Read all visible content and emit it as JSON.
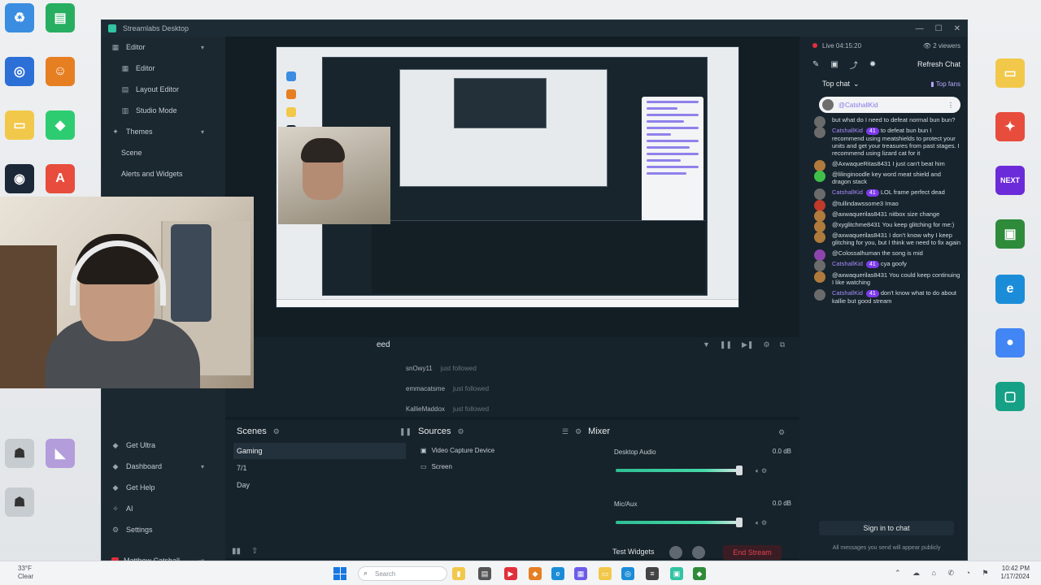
{
  "window": {
    "title": "Streamlabs Desktop"
  },
  "nav": {
    "top_items": [
      {
        "label": "Editor",
        "icon": "editor-icon",
        "expandable": true
      },
      {
        "label": "Editor",
        "icon": "editor-icon",
        "sub": true
      },
      {
        "label": "Layout Editor",
        "icon": "layout-icon",
        "sub": true
      },
      {
        "label": "Studio Mode",
        "icon": "studio-mode-icon",
        "sub": true
      },
      {
        "label": "Themes",
        "icon": "themes-icon",
        "expandable": true
      },
      {
        "label": "Scene",
        "icon": "",
        "sub": true
      },
      {
        "label": "Alerts and Widgets",
        "icon": "",
        "sub": true
      }
    ],
    "bottom_items": [
      {
        "label": "Get Ultra",
        "icon": "ultra-icon"
      },
      {
        "label": "Dashboard",
        "icon": "dashboard-icon",
        "expandable": true
      },
      {
        "label": "Get Help",
        "icon": "help-icon"
      },
      {
        "label": "AI",
        "icon": "ai-icon"
      },
      {
        "label": "Settings",
        "icon": "gear-icon"
      }
    ],
    "user_name": "Matthew Catshall"
  },
  "feed": {
    "title": "Event Feed",
    "title_visible": "eed",
    "rows": [
      {
        "user": "snOwy11",
        "detail": "just followed"
      },
      {
        "user": "emmacatsme",
        "detail": "just followed"
      },
      {
        "user": "KallieMaddox",
        "detail": "just followed"
      }
    ]
  },
  "scenes": {
    "title": "Scenes",
    "items": [
      "Gaming",
      "7/1",
      "Day"
    ],
    "active_index": 0
  },
  "sources": {
    "title": "Sources",
    "items": [
      {
        "label": "Video Capture Device",
        "icon": "camera-icon"
      },
      {
        "label": "Screen",
        "icon": "monitor-icon"
      }
    ]
  },
  "mixer": {
    "title": "Mixer",
    "channels": [
      {
        "name": "Desktop Audio",
        "db": "0.0 dB",
        "level": 0.95
      },
      {
        "name": "Mic/Aux",
        "db": "0.0 dB",
        "level": 0.95
      }
    ]
  },
  "footer": {
    "test_widgets": "Test Widgets",
    "end_stream": "End Stream"
  },
  "chat": {
    "live_label": "Live 04:15:20",
    "viewers": "2 viewers",
    "refresh": "Refresh Chat",
    "top_chat": "Top chat",
    "top_fans": "Top fans",
    "pinned_user": "@CatshallKid",
    "messages": [
      {
        "name": "",
        "text": "but what do I need to defeat normal bun bun?",
        "badge": "",
        "color": "#6b6b6b"
      },
      {
        "name": "CatshallKid",
        "text": "to defeat bun bun I recommend using meatshields to protect your units and get your treasures from past stages. I recommend using lizard cat for it",
        "badge": "41",
        "color": "#6b6b6b"
      },
      {
        "name": "",
        "text": "@AxwaqueRitas8431 I just can't beat him",
        "badge": "",
        "color": "#b07a3c"
      },
      {
        "name": "",
        "text": "@lilinginoodle key word meat shield and dragon stack",
        "badge": "",
        "color": "#3fbf4a"
      },
      {
        "name": "CatshallKid",
        "text": "LOL frame perfect dead",
        "badge": "41",
        "color": "#6b6b6b"
      },
      {
        "name": "",
        "text": "@tullindawssome3 Imao",
        "badge": "",
        "color": "#c0392b"
      },
      {
        "name": "",
        "text": "@axwaquerilas8431 nitbox size change",
        "badge": "",
        "color": "#b07a3c"
      },
      {
        "name": "",
        "text": "@xyglitchme8431 You keep glitching for me:)",
        "badge": "",
        "color": "#b07a3c"
      },
      {
        "name": "",
        "text": "@axwaquerilas8431 I don't know why I keep glitching for you, but I think we need to fix again",
        "badge": "",
        "color": "#b07a3c"
      },
      {
        "name": "",
        "text": "@Colossalhuman the song is mid",
        "badge": "",
        "color": "#8e44ad"
      },
      {
        "name": "CatshallKid",
        "text": "cya goofy",
        "badge": "41",
        "color": "#6b6b6b"
      },
      {
        "name": "",
        "text": "@axwaquerilas8431 You could keep continuing I like watching",
        "badge": "",
        "color": "#b07a3c"
      },
      {
        "name": "CatshallKid",
        "text": "don't know what to do about kallie but good stream",
        "badge": "41",
        "color": "#6b6b6b"
      }
    ],
    "sign_in": "Sign in to chat",
    "note": "All messages you send will appear publicly"
  },
  "desktop_icons": [
    {
      "label": "Recycle Bin",
      "color": "#3a8de0"
    },
    {
      "label": "Ubisoft",
      "color": "#2c6fd6"
    },
    {
      "label": "Folder",
      "color": "#f2c84b"
    },
    {
      "label": "Steam",
      "color": "#1b2838"
    },
    {
      "label": "",
      "color": "#27ae60"
    },
    {
      "label": "",
      "color": "#e67e22"
    },
    {
      "label": "",
      "color": "#2ecc71"
    },
    {
      "label": "",
      "color": "#e74c3c"
    },
    {
      "label": "Folder",
      "color": "#f2c84b"
    },
    {
      "label": "",
      "color": "#e74c3c"
    },
    {
      "label": "NEXT",
      "color": "#6c2bd9"
    },
    {
      "label": "",
      "color": "#2e8b3a"
    },
    {
      "label": "Edge",
      "color": "#1b8dd8"
    },
    {
      "label": "Chrome",
      "color": "#4285f4"
    },
    {
      "label": "",
      "color": "#16a085"
    }
  ],
  "taskbar": {
    "weather_temp": "33°F",
    "weather_desc": "Clear",
    "search_placeholder": "Search",
    "time": "10:42 PM",
    "date": "1/17/2024"
  }
}
